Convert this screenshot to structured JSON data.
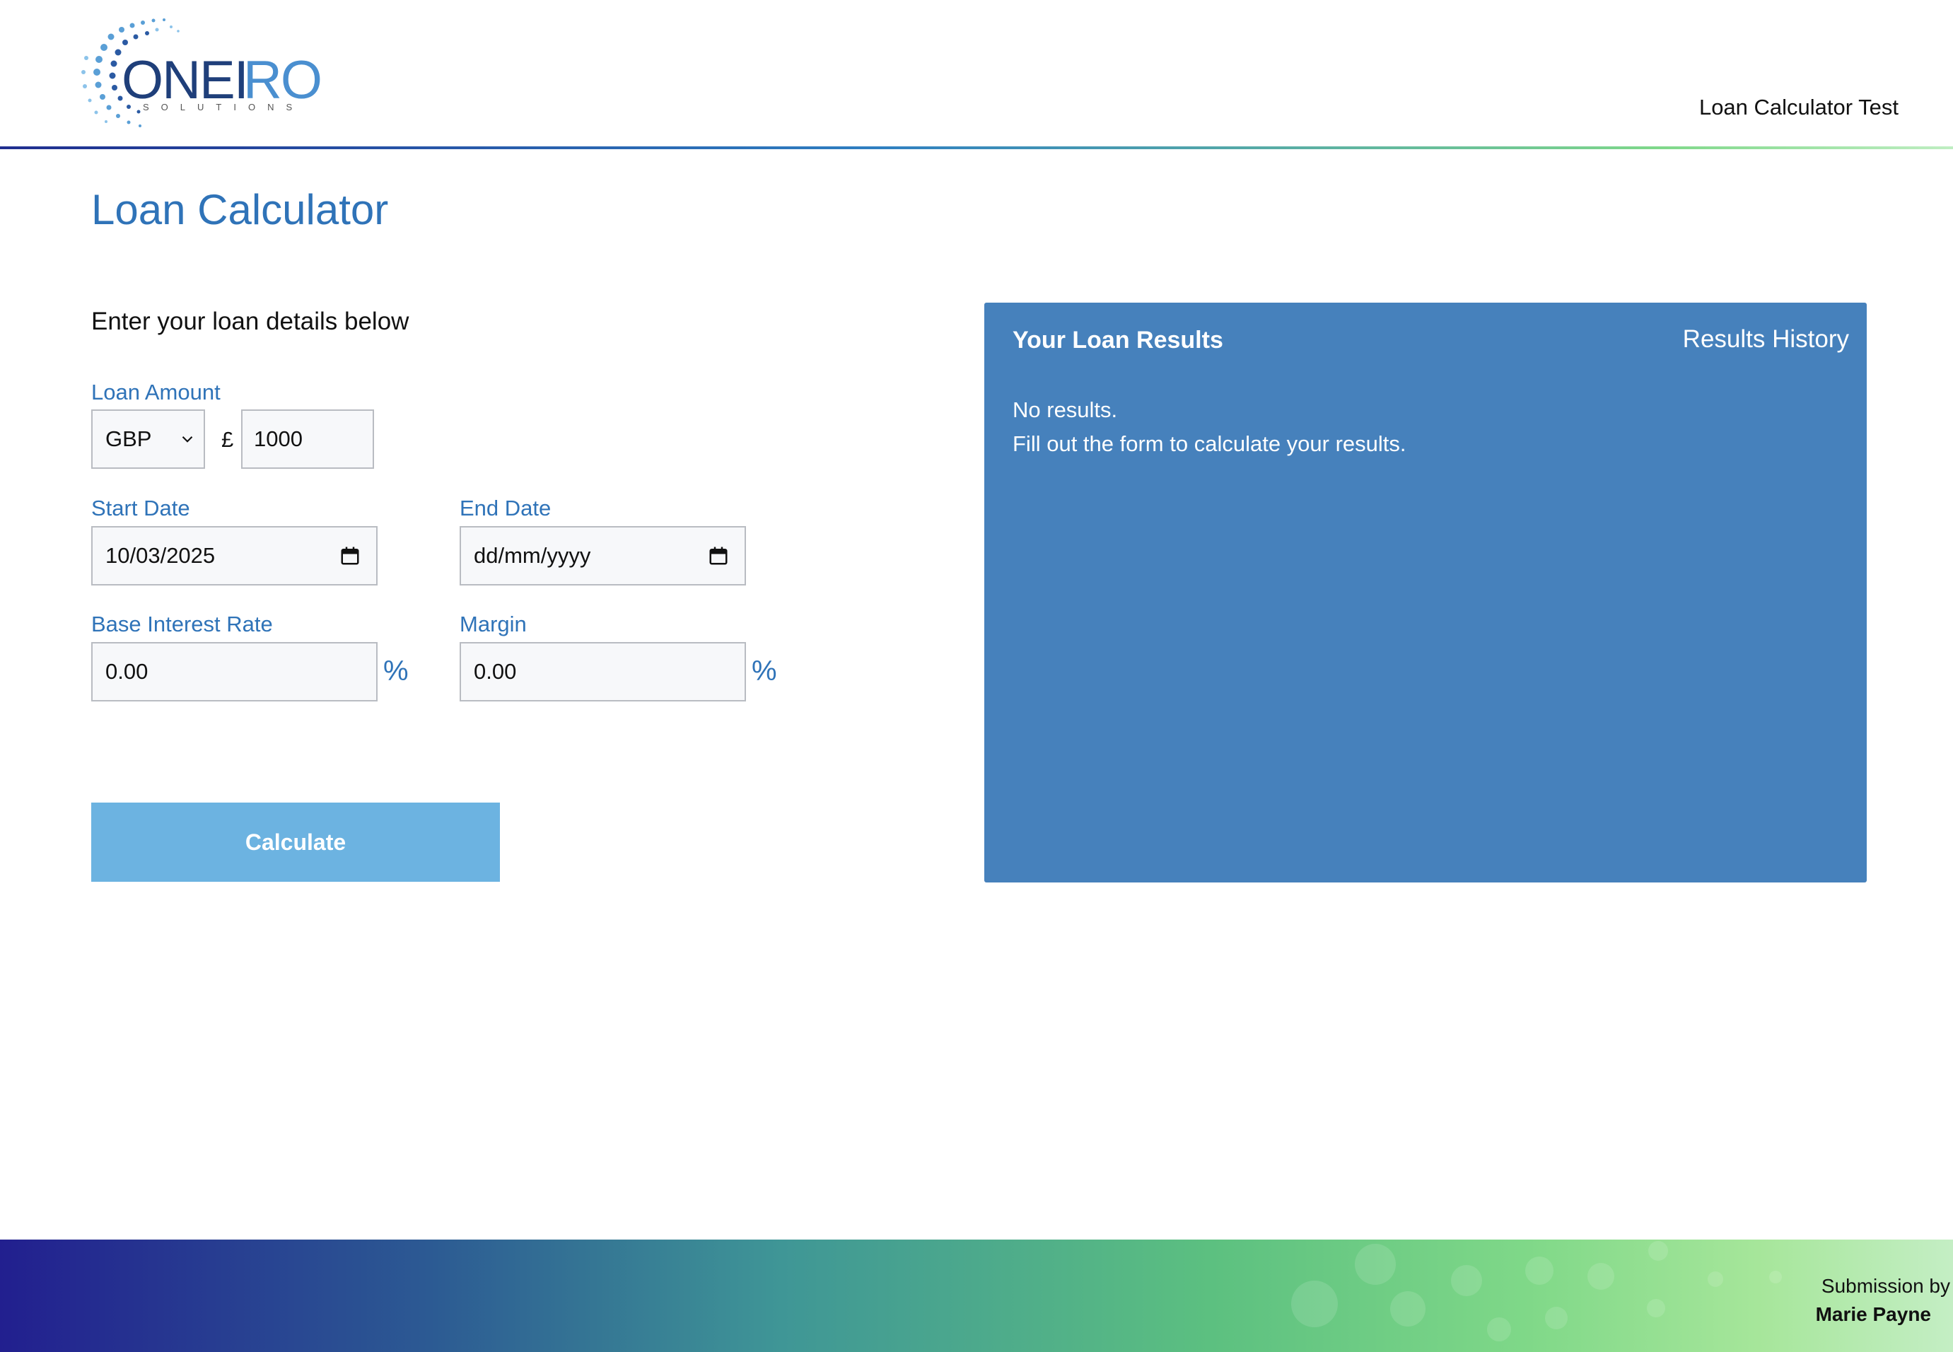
{
  "header": {
    "logo_text": "ONEIRO",
    "logo_subtext": "SOLUTIONS",
    "title": "Loan Calculator Test"
  },
  "main": {
    "heading": "Loan Calculator",
    "intro": "Enter your loan details below",
    "loan_amount": {
      "label": "Loan Amount",
      "currency_selected": "GBP",
      "currency_symbol": "£",
      "value": "1000"
    },
    "start_date": {
      "label": "Start Date",
      "value": "10/03/2025",
      "icon": "calendar-icon"
    },
    "end_date": {
      "label": "End Date",
      "placeholder": "dd/mm/yyyy",
      "icon": "calendar-icon"
    },
    "base_rate": {
      "label": "Base Interest Rate",
      "value": "0.00",
      "unit": "%"
    },
    "margin": {
      "label": "Margin",
      "value": "0.00",
      "unit": "%"
    },
    "calculate_label": "Calculate"
  },
  "results": {
    "title": "Your Loan Results",
    "history_label": "Results History",
    "message_line1": "No results.",
    "message_line2": "Fill out the form to calculate your results."
  },
  "footer": {
    "submission_label": "Submission by",
    "author": "Marie Payne"
  },
  "colors": {
    "accent": "#2f73b8",
    "results_panel": "#4681bc",
    "button": "#6cb3e1"
  }
}
